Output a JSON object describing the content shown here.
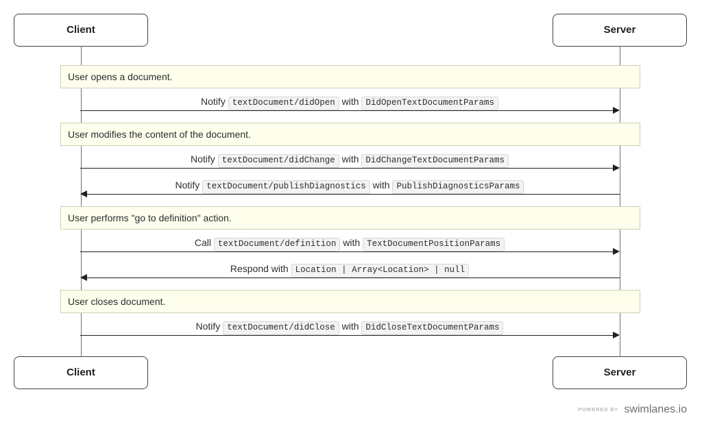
{
  "participants": {
    "client": "Client",
    "server": "Server"
  },
  "notes": {
    "n1": "User opens a document.",
    "n2": "User modifies the content of the document.",
    "n3": "User performs \"go to definition\" action.",
    "n4": "User closes document."
  },
  "messages": {
    "m1": {
      "verb": "Notify",
      "method": "textDocument/didOpen",
      "mid": "with",
      "param": "DidOpenTextDocumentParams"
    },
    "m2": {
      "verb": "Notify",
      "method": "textDocument/didChange",
      "mid": "with",
      "param": "DidChangeTextDocumentParams"
    },
    "m3": {
      "verb": "Notify",
      "method": "textDocument/publishDiagnostics",
      "mid": "with",
      "param": "PublishDiagnosticsParams"
    },
    "m4": {
      "verb": "Call",
      "method": "textDocument/definition",
      "mid": "with",
      "param": "TextDocumentPositionParams"
    },
    "m5": {
      "verb": "Respond with",
      "param": "Location | Array<Location> | null"
    },
    "m6": {
      "verb": "Notify",
      "method": "textDocument/didClose",
      "mid": "with",
      "param": "DidCloseTextDocumentParams"
    }
  },
  "footer": {
    "powered_by": "POWERED BY",
    "brand": "swimlanes.io"
  },
  "chart_data": {
    "type": "sequence",
    "participants": [
      "Client",
      "Server"
    ],
    "events": [
      {
        "kind": "note",
        "text": "User opens a document."
      },
      {
        "kind": "message",
        "from": "Client",
        "to": "Server",
        "label": "Notify textDocument/didOpen with DidOpenTextDocumentParams"
      },
      {
        "kind": "note",
        "text": "User modifies the content of the document."
      },
      {
        "kind": "message",
        "from": "Client",
        "to": "Server",
        "label": "Notify textDocument/didChange with DidChangeTextDocumentParams"
      },
      {
        "kind": "message",
        "from": "Server",
        "to": "Client",
        "label": "Notify textDocument/publishDiagnostics with PublishDiagnosticsParams"
      },
      {
        "kind": "note",
        "text": "User performs \"go to definition\" action."
      },
      {
        "kind": "message",
        "from": "Client",
        "to": "Server",
        "label": "Call textDocument/definition with TextDocumentPositionParams"
      },
      {
        "kind": "message",
        "from": "Server",
        "to": "Client",
        "label": "Respond with Location | Array<Location> | null"
      },
      {
        "kind": "note",
        "text": "User closes document."
      },
      {
        "kind": "message",
        "from": "Client",
        "to": "Server",
        "label": "Notify textDocument/didClose with DidCloseTextDocumentParams"
      }
    ]
  }
}
